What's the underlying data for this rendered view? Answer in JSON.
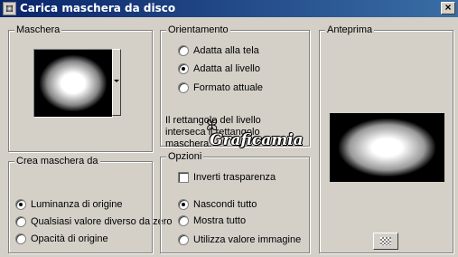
{
  "window": {
    "title": "Carica maschera da disco",
    "close_label": "×"
  },
  "mask_group": {
    "legend": "Maschera"
  },
  "orientation_group": {
    "legend": "Orientamento",
    "options": [
      {
        "label": "Adatta alla tela",
        "selected": false
      },
      {
        "label": "Adatta al livello",
        "selected": true
      },
      {
        "label": "Formato attuale",
        "selected": false
      }
    ],
    "info": "Il rettangolo del livello interseca il rettangolo maschera."
  },
  "preview_group": {
    "legend": "Anteprima"
  },
  "create_group": {
    "legend": "Crea maschera da",
    "options": [
      {
        "label": "Luminanza di origine",
        "selected": true
      },
      {
        "label": "Qualsiasi valore diverso da zero",
        "selected": false
      },
      {
        "label": "Opacità di origine",
        "selected": false
      }
    ]
  },
  "options_group": {
    "legend": "Opzioni",
    "invert_label": "Inverti trasparenza",
    "invert_checked": false,
    "options": [
      {
        "label": "Nascondi tutto",
        "selected": true
      },
      {
        "label": "Mostra tutto",
        "selected": false
      },
      {
        "label": "Utilizza valore immagine",
        "selected": false
      }
    ]
  },
  "watermark": {
    "text": "Graficamia",
    "icon": "butterfly-icon"
  },
  "colors": {
    "titlebar_start": "#0a246a",
    "titlebar_end": "#3a6ea5",
    "dialog_bg": "#d4d0c8"
  }
}
